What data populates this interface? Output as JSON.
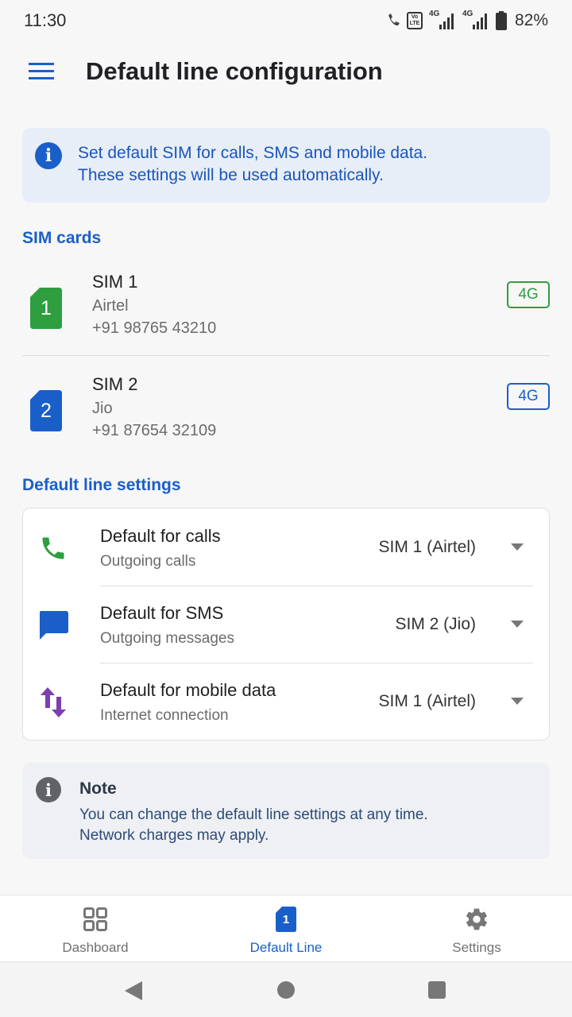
{
  "status_bar": {
    "time": "11:30",
    "battery": "82%",
    "volte_label": "Vo LTE",
    "sim1_network": "4G",
    "sim2_network": "4G"
  },
  "app_bar": {
    "title": "Default line configuration"
  },
  "info_banner": {
    "line1": "Set default SIM for calls, SMS and mobile data.",
    "line2": "These settings will be used automatically."
  },
  "sim_section": {
    "title": "SIM cards",
    "sims": [
      {
        "slot": "1",
        "name": "SIM 1",
        "carrier": "Airtel",
        "number": "+91 98765 43210",
        "badge": "4G",
        "color": "#2e9e3e"
      },
      {
        "slot": "2",
        "name": "SIM 2",
        "carrier": "Jio",
        "number": "+91 87654 32109",
        "badge": "4G",
        "color": "#1a5fc9"
      }
    ]
  },
  "default_section": {
    "title": "Default line settings",
    "rows": [
      {
        "title": "Default for calls",
        "subtitle": "Outgoing calls",
        "value": "SIM 1 (Airtel)",
        "icon": "phone-icon"
      },
      {
        "title": "Default for SMS",
        "subtitle": "Outgoing messages",
        "value": "SIM 2 (Jio)",
        "icon": "message-icon"
      },
      {
        "title": "Default for mobile data",
        "subtitle": "Internet connection",
        "value": "SIM 1 (Airtel)",
        "icon": "data-transfer-icon"
      }
    ]
  },
  "note": {
    "title": "Note",
    "line1": "You can change the default line settings at any time.",
    "line2": "Network charges may apply."
  },
  "bottom_nav": {
    "items": [
      {
        "label": "Dashboard",
        "icon": "grid-icon"
      },
      {
        "label": "Default Line",
        "icon": "sim-icon",
        "badge": "1"
      },
      {
        "label": "Settings",
        "icon": "gear-icon"
      }
    ],
    "active_index": 1
  },
  "colors": {
    "accent": "#1a5fc9",
    "sim1": "#2e9e3e",
    "sim2": "#1a5fc9",
    "data": "#7b3fb0"
  }
}
